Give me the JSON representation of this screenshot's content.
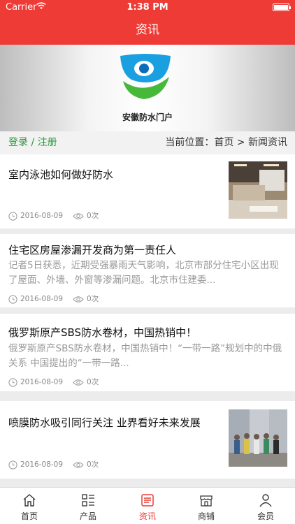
{
  "status_bar": {
    "carrier": "Carrier",
    "time": "1:38 PM"
  },
  "nav": {
    "title": "资讯"
  },
  "banner": {
    "logo_text": "安徽防水门户"
  },
  "location_bar": {
    "login_link": "登录 / 注册",
    "location_text": "当前位置：首页 > 新闻资讯"
  },
  "news": [
    {
      "title": "室内泳池如何做好防水",
      "summary": "",
      "date": "2016-08-09",
      "views": "0次",
      "has_image": true
    },
    {
      "title": "住宅区房屋渗漏开发商为第一责任人",
      "summary": "记者5日获悉，近期受强暴雨天气影响，北京市部分住宅小区出现了屋面、外墙、外窗等渗漏问题。北京市住建委...",
      "date": "2016-08-09",
      "views": "0次",
      "has_image": false
    },
    {
      "title": "俄罗斯原产SBS防水卷材，中国热销中！",
      "summary": "俄罗斯原产SBS防水卷材，中国热销中！“一带一路”规划中的中俄关系 中国提出的“一带一路...",
      "date": "2016-08-09",
      "views": "0次",
      "has_image": false
    },
    {
      "title": "喷膜防水吸引同行关注 业界看好未来发展",
      "summary": "",
      "date": "2016-08-09",
      "views": "0次",
      "has_image": true
    }
  ],
  "tabbar": {
    "items": [
      {
        "label": "首页",
        "icon": "home-icon"
      },
      {
        "label": "产品",
        "icon": "product-grid-icon"
      },
      {
        "label": "资讯",
        "icon": "news-icon",
        "active": true
      },
      {
        "label": "商铺",
        "icon": "store-icon"
      },
      {
        "label": "会员",
        "icon": "user-icon"
      }
    ]
  },
  "colors": {
    "brand_red": "#ee3b36",
    "login_green": "#2e9a3a"
  }
}
